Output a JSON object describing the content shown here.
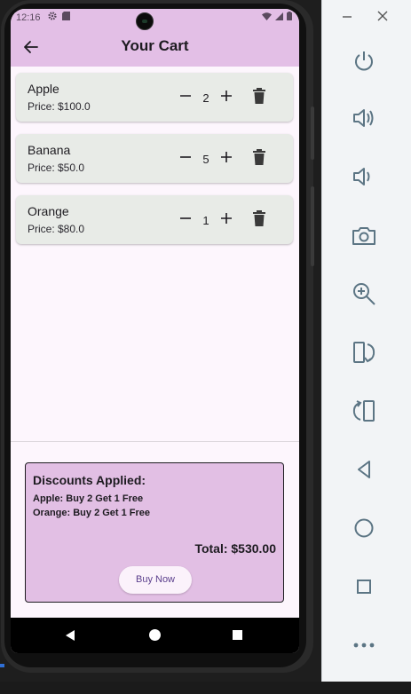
{
  "status_bar": {
    "time": "12:16",
    "left_icons": [
      "gear-icon",
      "sd-card-icon"
    ],
    "right_icons": [
      "wifi-icon",
      "signal-icon",
      "battery-icon"
    ]
  },
  "app_bar": {
    "title": "Your Cart",
    "back_icon": "arrow-back-icon"
  },
  "cart": {
    "items": [
      {
        "name": "Apple",
        "price_text": "Price: $100.0",
        "quantity": "2"
      },
      {
        "name": "Banana",
        "price_text": "Price: $50.0",
        "quantity": "5"
      },
      {
        "name": "Orange",
        "price_text": "Price: $80.0",
        "quantity": "1"
      }
    ]
  },
  "summary": {
    "title": "Discounts Applied:",
    "discounts": [
      "Apple: Buy 2 Get 1 Free",
      "Orange: Buy 2 Get 1 Free"
    ],
    "total": "Total: $530.00",
    "buy_label": "Buy Now"
  },
  "nav_bar": {
    "buttons": [
      "nav-back-icon",
      "nav-home-icon",
      "nav-recents-icon"
    ]
  },
  "emulator_panel": {
    "window_controls": [
      "minimize-icon",
      "close-icon"
    ],
    "buttons": [
      "power-icon",
      "volume-up-icon",
      "volume-down-icon",
      "camera-icon",
      "zoom-icon",
      "rotate-left-icon",
      "rotate-right-icon",
      "back-icon",
      "home-icon",
      "overview-icon",
      "more-icon"
    ]
  },
  "colors": {
    "app_bar": "#e3bfe6",
    "card": "#e8ebe7",
    "summary": "#e2bfe4",
    "background": "#fdf6fd",
    "button_text": "#5b3f8c"
  }
}
